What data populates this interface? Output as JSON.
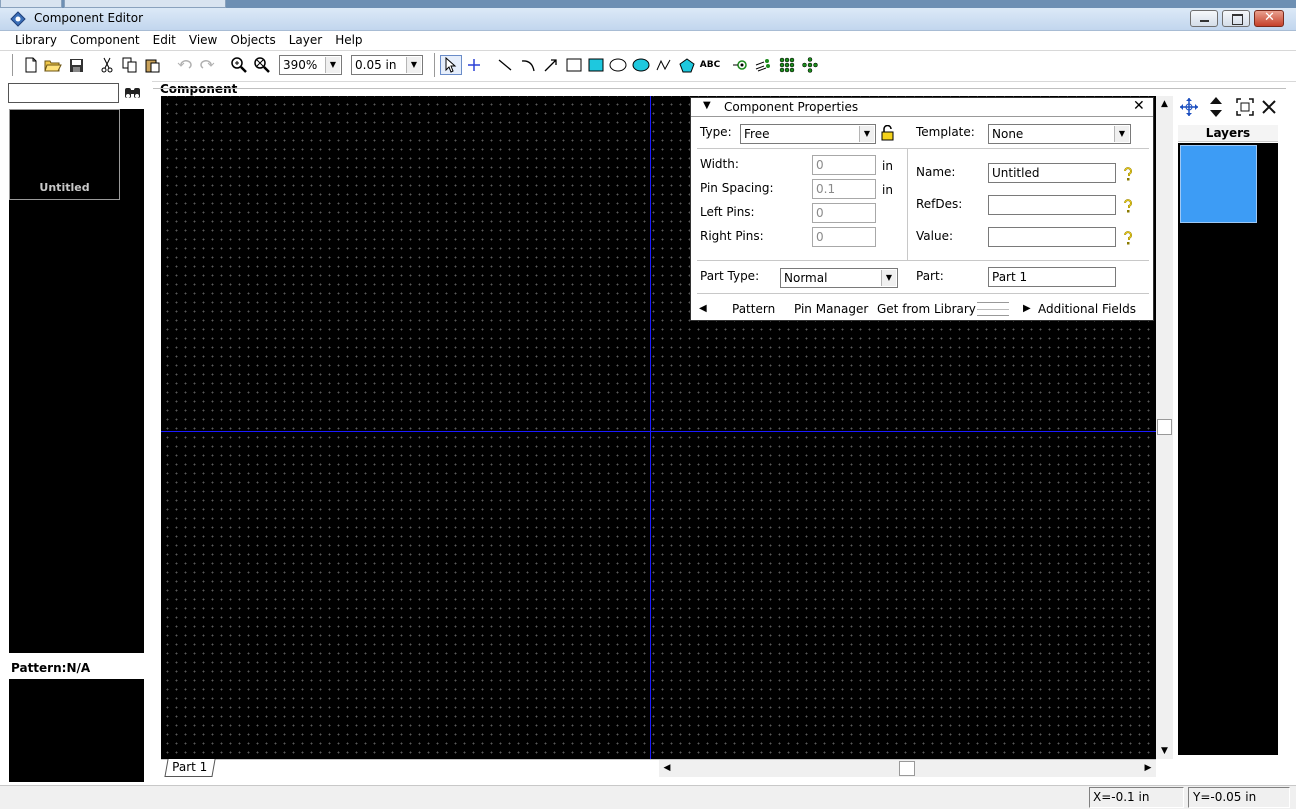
{
  "window": {
    "title": "Component Editor"
  },
  "menu": [
    "Library",
    "Component",
    "Edit",
    "View",
    "Objects",
    "Layer",
    "Help"
  ],
  "toolbar": {
    "zoom": "390%",
    "grid": "0.05 in",
    "text_tool": "ABC"
  },
  "left_panel": {
    "search_value": "",
    "thumb_label": "Untitled",
    "pattern_label": "Pattern:N/A"
  },
  "canvas": {
    "title": "Component",
    "tab": "Part 1"
  },
  "props": {
    "title": "Component Properties",
    "type_label": "Type:",
    "type_value": "Free",
    "template_label": "Template:",
    "template_value": "None",
    "width_label": "Width:",
    "width_value": "0",
    "width_unit": "in",
    "pinspacing_label": "Pin Spacing:",
    "pinspacing_value": "0.1",
    "pinspacing_unit": "in",
    "leftpins_label": "Left Pins:",
    "leftpins_value": "0",
    "rightpins_label": "Right Pins:",
    "rightpins_value": "0",
    "name_label": "Name:",
    "name_value": "Untitled",
    "refdes_label": "RefDes:",
    "refdes_value": "",
    "value_label": "Value:",
    "value_value": "",
    "parttype_label": "Part Type:",
    "parttype_value": "Normal",
    "part_label": "Part:",
    "part_value": "Part 1",
    "tabs": {
      "pattern": "Pattern",
      "pin_manager": "Pin Manager",
      "get_from_library": "Get from Library",
      "additional_fields": "Additional Fields"
    }
  },
  "layers": {
    "title": "Layers",
    "color": "#3d9cf5"
  },
  "status": {
    "x": "X=-0.1 in",
    "y": "Y=-0.05 in"
  },
  "colors": {
    "canvas_bg": "#000000",
    "axis": "#1a1aff",
    "grid_dot": "#4a4a4a",
    "title_bar": "#cfe0f2"
  }
}
